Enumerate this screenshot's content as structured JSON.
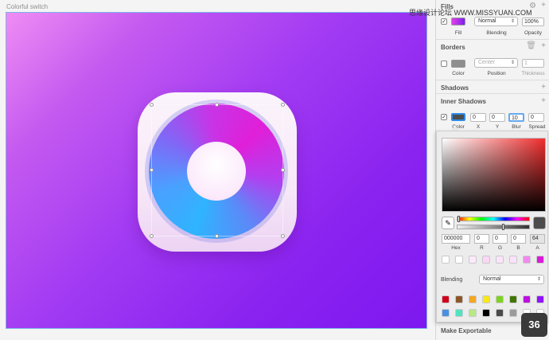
{
  "canvas": {
    "artboard_label": "Colorful switch"
  },
  "watermark": "思缘设计论坛 WWW.MISSYUAN.COM",
  "inspector": {
    "fills": {
      "header": "Fills",
      "blending_value": "Normal",
      "opacity_value": "100%",
      "labels": {
        "fill": "Fill",
        "blending": "Blending",
        "opacity": "Opacity"
      },
      "swatch_color": "#c03bf0"
    },
    "borders": {
      "header": "Borders",
      "position_value": "Center",
      "thickness_value": "1",
      "labels": {
        "color": "Color",
        "position": "Position",
        "thickness": "Thickness"
      }
    },
    "shadows": {
      "header": "Shadows"
    },
    "inner_shadows": {
      "header": "Inner Shadows",
      "x": "0",
      "y": "0",
      "blur": "10",
      "spread": "0",
      "labels": {
        "color": "Color",
        "x": "X",
        "y": "Y",
        "blur": "Blur",
        "spread": "Spread"
      }
    },
    "make_exportable": "Make Exportable"
  },
  "color_picker": {
    "hex": "000000",
    "r": "0",
    "g": "0",
    "b": "0",
    "a": "64",
    "labels": {
      "hex": "Hex",
      "r": "R",
      "g": "G",
      "b": "B",
      "a": "A"
    },
    "blending_label": "Blending",
    "blending_value": "Normal",
    "recent_colors": [
      "#ffffff",
      "#ffffff",
      "#fde9fb",
      "#fbd6f6",
      "#fbe4fb",
      "#fde2fb",
      "#f089ee",
      "#d81bd9"
    ],
    "preset_colors_row1": [
      "#d0021b",
      "#8b572a",
      "#f5a623",
      "#f8e71c",
      "#7ed321",
      "#417505",
      "#bd10e0",
      "#9013fe"
    ],
    "preset_colors_row2": [
      "#4a90e2",
      "#50e3c2",
      "#b8e986",
      "#000000",
      "#4a4a4a",
      "#9b9b9b",
      "#ffffff",
      "#ffffff"
    ]
  },
  "slide_number": "36"
}
